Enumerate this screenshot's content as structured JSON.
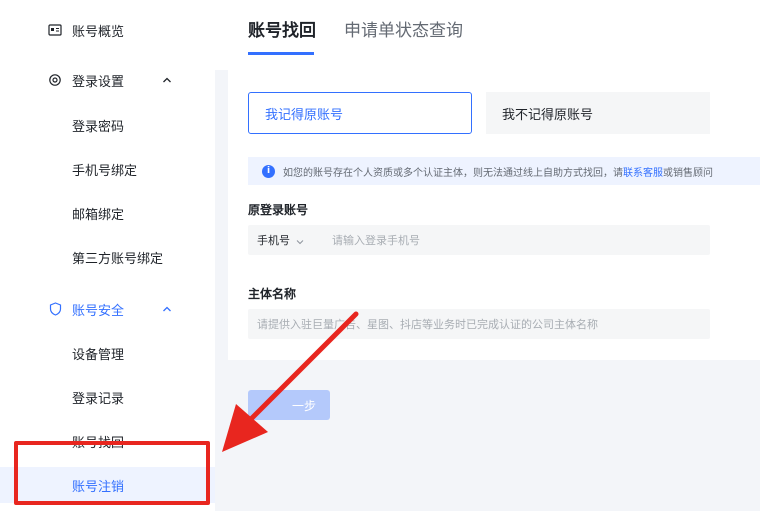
{
  "sidebar": {
    "overview": "账号概览",
    "login_settings": "登录设置",
    "login_password": "登录密码",
    "phone_bind": "手机号绑定",
    "email_bind": "邮箱绑定",
    "third_party_bind": "第三方账号绑定",
    "account_security": "账号安全",
    "device_management": "设备管理",
    "login_records": "登录记录",
    "account_recovery": "账号找回",
    "account_cancel": "账号注销"
  },
  "tabs": {
    "recovery": "账号找回",
    "status_query": "申请单状态查询"
  },
  "options": {
    "remember": "我记得原账号",
    "forgot": "我不记得原账号"
  },
  "notice": {
    "text": "如您的账号存在个人资质或多个认证主体，则无法通过线上自助方式找回，请",
    "link": "联系客服",
    "tail": "或销售顾问"
  },
  "form": {
    "original_account_label": "原登录账号",
    "account_type": "手机号",
    "phone_placeholder": "请输入登录手机号",
    "entity_label": "主体名称",
    "entity_placeholder": "请提供入驻巨量广告、星图、抖店等业务时已完成认证的公司主体名称"
  },
  "next_button": "一步",
  "colors": {
    "accent": "#3370ff",
    "highlight": "#e8261f"
  }
}
